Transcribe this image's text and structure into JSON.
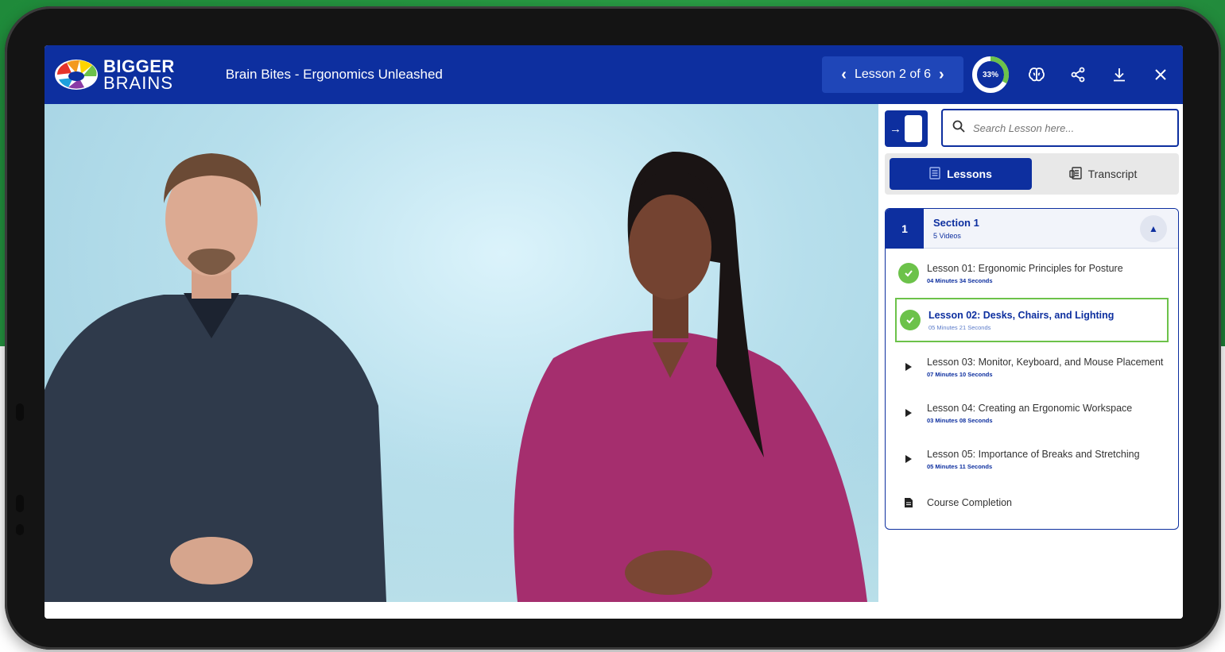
{
  "brand": {
    "name_line1": "BIGGER",
    "name_line2": "BRAINS",
    "header_bg": "#0d2f9f",
    "accent_green": "#6cc24a"
  },
  "header": {
    "course_title": "Brain Bites - Ergonomics Unleashed",
    "lesson_nav": {
      "prev_icon": "chevron-left-icon",
      "label": "Lesson 2 of 6",
      "next_icon": "chevron-right-icon"
    },
    "progress": {
      "label": "33%",
      "value": 0.33
    },
    "icons": [
      "brain-icon",
      "share-icon",
      "download-icon",
      "close-icon"
    ]
  },
  "sidebar": {
    "collapse_icon": "collapse-panel-icon",
    "search": {
      "placeholder": "Search Lesson here...",
      "value": ""
    },
    "tabs": [
      {
        "label": "Lessons",
        "icon": "list-icon",
        "active": true
      },
      {
        "label": "Transcript",
        "icon": "transcript-icon",
        "active": false
      }
    ],
    "section": {
      "number": "1",
      "title": "Section 1",
      "subtitle": "5 Videos",
      "expanded": true,
      "lessons": [
        {
          "title": "Lesson 01: Ergonomic Principles for Posture",
          "duration": "04 Minutes 34 Seconds",
          "status": "completed"
        },
        {
          "title": "Lesson 02: Desks, Chairs, and Lighting",
          "duration": "05 Minutes 21 Seconds",
          "status": "current"
        },
        {
          "title": "Lesson 03: Monitor, Keyboard, and Mouse Placement",
          "duration": "07 Minutes 10 Seconds",
          "status": "play"
        },
        {
          "title": "Lesson 04: Creating an Ergonomic Workspace",
          "duration": "03 Minutes 08 Seconds",
          "status": "play"
        },
        {
          "title": "Lesson 05: Importance of Breaks and Stretching",
          "duration": "05 Minutes 11 Seconds",
          "status": "play"
        },
        {
          "title": "Course Completion",
          "duration": "",
          "status": "document"
        }
      ]
    }
  }
}
